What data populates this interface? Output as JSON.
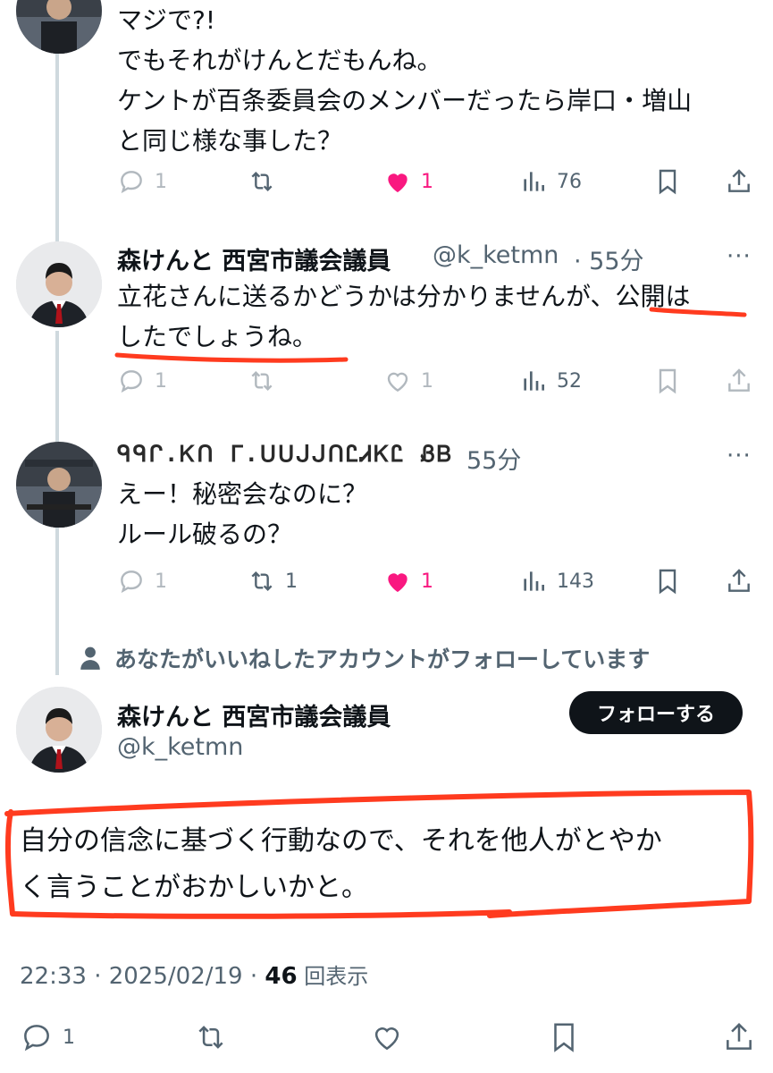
{
  "tweets": [
    {
      "name": "",
      "handle": "",
      "time": "",
      "lines": [
        "マジで?!",
        "でもそれがけんとだもんね。",
        "ケントが百条委員会のメンバーだったら岸口・増山",
        "と同じ様な事した？"
      ],
      "replies": "1",
      "retweets": "",
      "likes": "1",
      "views": "76",
      "liked": true,
      "faded": false
    },
    {
      "name": "森けんと 西宮市議会議員",
      "handle": "@k_ketmn",
      "time": "· 55分",
      "lines": [
        "立花さんに送るかどうかは分かりませんが、公開は",
        "したでしょうね。"
      ],
      "replies": "1",
      "retweets": "",
      "likes": "1",
      "views": "52",
      "liked": false,
      "faded": true
    },
    {
      "name": "ᑫᑫᒋ.Ꮶᑎ ᒥ.ᑌᑌᒍᒍᑎᏝᏗᏦᏝ ᏰᏴ",
      "handle": "",
      "time": "55分",
      "lines": [
        "えー！秘密会なのに？",
        "ルール破るの？"
      ],
      "replies": "1",
      "retweets": "1",
      "likes": "1",
      "views": "143",
      "liked": true,
      "faded": false
    }
  ],
  "social_context": "あなたがいいねしたアカウントがフォローしています",
  "main_tweet": {
    "name": "森けんと 西宮市議会議員",
    "handle": "@k_ketmn",
    "follow_label": "フォローする",
    "lines": [
      "自分の信念に基づく行動なので、それを他人がとやか",
      "く言うことがおかしいかと。"
    ],
    "time": "22:33 · 2025/02/19 · ",
    "views_count": "46",
    "views_label": " 回表示",
    "replies": "1"
  },
  "colors": {
    "like_pink": "#f91880",
    "annotation_red": "#ff3b1f",
    "muted": "#536471"
  }
}
